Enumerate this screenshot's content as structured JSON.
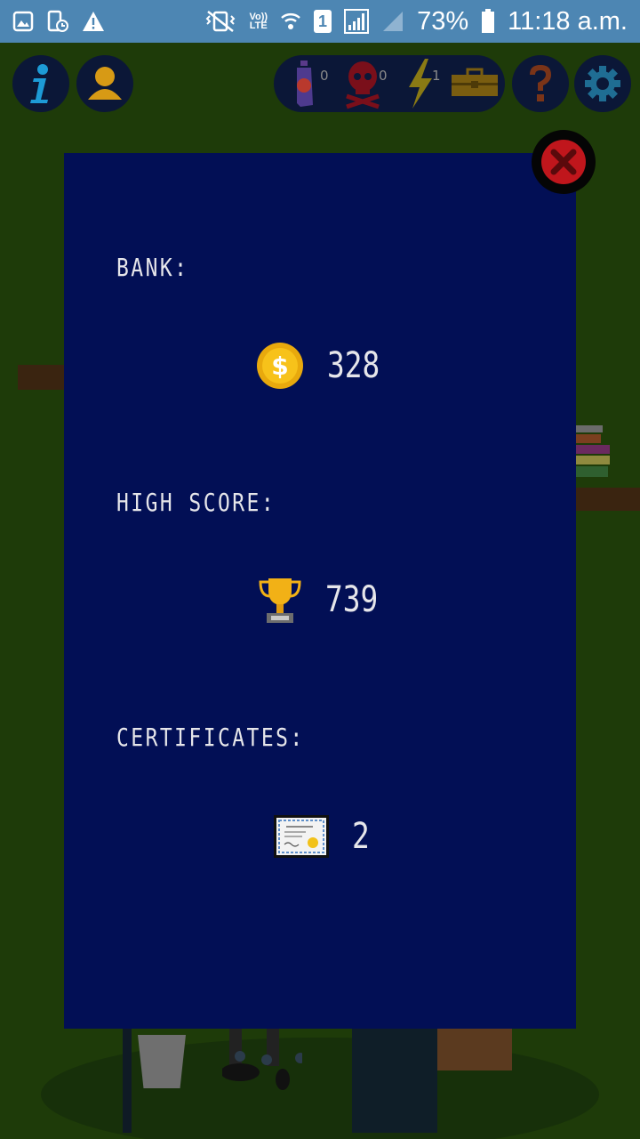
{
  "status_bar": {
    "network_badge_top": "Vo))",
    "network_badge_bottom": "LTE",
    "sim_slot": "1",
    "battery_percent": "73%",
    "time": "11:18 a.m."
  },
  "hud": {
    "spray_count": "0",
    "skull_count": "0",
    "lightning_count": "1"
  },
  "dialog": {
    "bank_label": "BANK:",
    "bank_value": "328",
    "high_score_label": "HIGH SCORE:",
    "high_score_value": "739",
    "certificates_label": "CERTIFICATES:",
    "certificates_value": "2"
  },
  "colors": {
    "status_bar": "#4d86b3",
    "dialog_bg": "#020f55",
    "scene_bg": "#1e3b09",
    "close_red": "#c0161c"
  },
  "icons": [
    "gallery-icon",
    "screenshot-icon",
    "warning-icon",
    "vibrate-mute-icon",
    "wifi-icon",
    "signal-icon",
    "battery-icon",
    "info-icon",
    "profile-icon",
    "spray-can-icon",
    "skull-icon",
    "lightning-icon",
    "toolbox-icon",
    "help-icon",
    "settings-gear-icon",
    "close-icon",
    "coin-icon",
    "trophy-icon",
    "certificate-icon"
  ]
}
